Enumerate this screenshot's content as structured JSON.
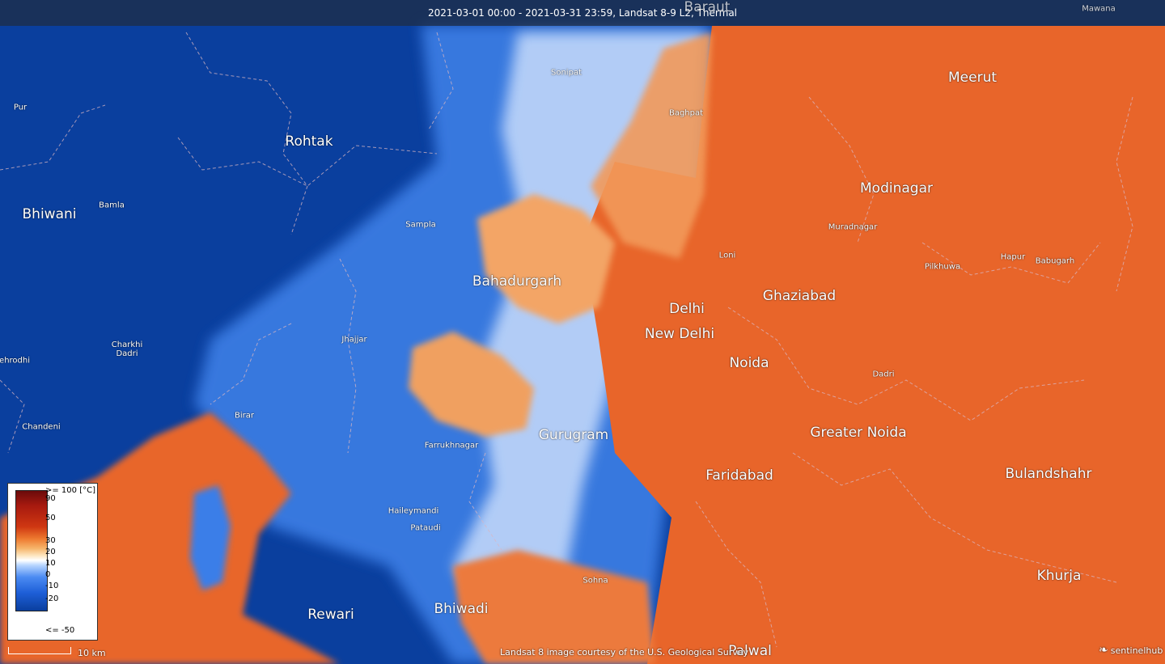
{
  "header": {
    "title": "2021-03-01 00:00 - 2021-03-31 23:59, Landsat 8-9 L2, Thermal"
  },
  "map": {
    "colors": {
      "cold": "#0a3f9e",
      "cool": "#2b6fe0",
      "neutral": "#ffffff",
      "warm": "#f5c08a",
      "hot": "#e8652a"
    },
    "places_big": [
      "Baraut",
      "Meerut",
      "Rohtak",
      "Modinagar",
      "Bhiwani",
      "Ghaziabad",
      "Bahadurgarh",
      "Delhi",
      "New Delhi",
      "Noida",
      "Greater Noida",
      "Gurugram",
      "Faridabad",
      "Bulandshahr",
      "Khurja",
      "Rewari",
      "Bhiwadi",
      "Palwal"
    ],
    "places_small": [
      "Mawana",
      "Sonipat",
      "Pur",
      "Baghpat",
      "Bamla",
      "Sampla",
      "Muradnagar",
      "Loni",
      "Pilkhuwa",
      "Hapur",
      "Babugarh",
      "Charkhi Dadri",
      "Jhajjar",
      "Dadri",
      "Birar",
      "Chandeni",
      "Farrukhnagar",
      "Haileymandi",
      "Pataudi",
      "Sohna",
      "Kehrodhi"
    ]
  },
  "legend": {
    "unit_label": ">= 100 [°C]",
    "ticks": [
      "90",
      "50",
      "30",
      "20",
      "10",
      "0",
      "-10",
      "-20"
    ],
    "min_label": "<= -50"
  },
  "scale": {
    "label": "10 km"
  },
  "footer": {
    "attribution": "Landsat 8 image courtesy of the U.S. Geological Survey",
    "brand": "sentinelhub"
  }
}
